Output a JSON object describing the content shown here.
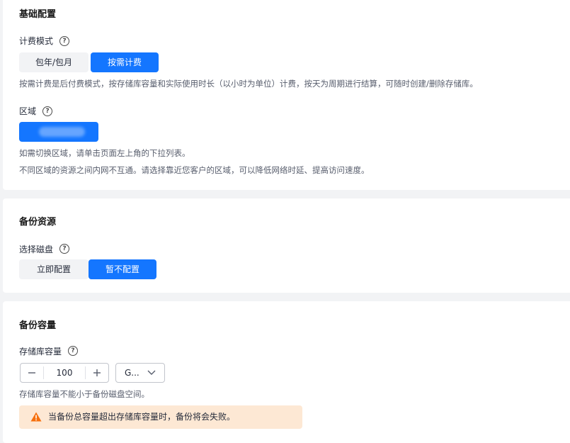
{
  "basic": {
    "title": "基础配置",
    "billing": {
      "label": "计费模式",
      "help": "?",
      "options": [
        "包年/包月",
        "按需计费"
      ],
      "selected": "按需计费",
      "hint": "按需计费是后付费模式，按存储库容量和实际使用时长（以小时为单位）计费，按天为周期进行结算，可随时创建/删除存储库。"
    },
    "region": {
      "label": "区域",
      "help": "?",
      "hint1": "如需切换区域，请单击页面左上角的下拉列表。",
      "hint2": "不同区域的资源之间内网不互通。请选择靠近您客户的区域，可以降低网络时延、提高访问速度。"
    }
  },
  "backup": {
    "title": "备份资源",
    "disk": {
      "label": "选择磁盘",
      "help": "?",
      "options": [
        "立即配置",
        "暂不配置"
      ],
      "selected": "暂不配置"
    }
  },
  "capacity": {
    "title": "备份容量",
    "vault": {
      "label": "存储库容量",
      "help": "?",
      "value": "100",
      "unit": "G...",
      "hint": "存储库容量不能小于备份磁盘空间。",
      "warning": "当备份总容量超出存储库容量时，备份将会失败。"
    }
  },
  "colors": {
    "accent": "#1476ff",
    "warning_bg": "#fde8d4",
    "warning_icon": "#f66f0c"
  }
}
